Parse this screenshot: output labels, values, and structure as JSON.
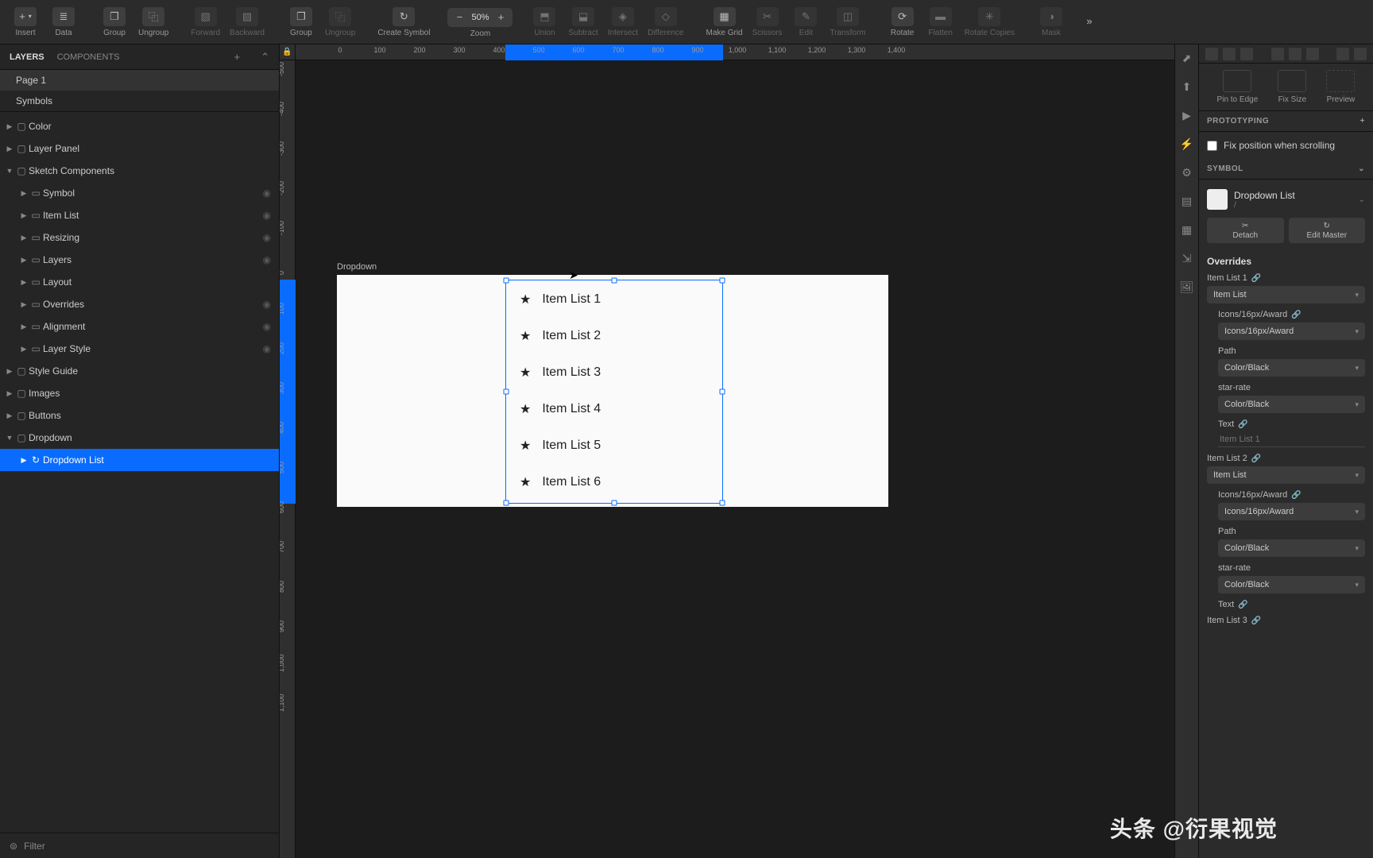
{
  "toolbar": {
    "insert": "Insert",
    "data": "Data",
    "group": "Group",
    "ungroup": "Ungroup",
    "forward": "Forward",
    "backward": "Backward",
    "group2": "Group",
    "ungroup2": "Ungroup",
    "create_symbol": "Create Symbol",
    "zoom": "Zoom",
    "zoom_value": "50%",
    "union": "Union",
    "subtract": "Subtract",
    "intersect": "Intersect",
    "difference": "Difference",
    "make_grid": "Make Grid",
    "scissors": "Scissors",
    "edit": "Edit",
    "transform": "Transform",
    "rotate": "Rotate",
    "flatten": "Flatten",
    "rotate_copies": "Rotate Copies",
    "mask": "Mask"
  },
  "left": {
    "tab_layers": "LAYERS",
    "tab_components": "COMPONENTS",
    "page1": "Page 1",
    "symbols": "Symbols",
    "filter": "Filter",
    "groups": {
      "color": "Color",
      "layer_panel": "Layer Panel",
      "sketch_components": "Sketch Components",
      "symbol": "Symbol",
      "item_list": "Item List",
      "resizing": "Resizing",
      "layers": "Layers",
      "layout": "Layout",
      "overrides": "Overrides",
      "alignment": "Alignment",
      "layer_style": "Layer Style",
      "style_guide": "Style Guide",
      "images": "Images",
      "buttons": "Buttons",
      "dropdown": "Dropdown",
      "dropdown_list": "Dropdown List"
    }
  },
  "canvas": {
    "artboard_label": "Dropdown",
    "h_ticks": [
      "0",
      "100",
      "200",
      "300",
      "400",
      "500",
      "600",
      "700",
      "800",
      "900",
      "1,000",
      "1,100",
      "1,200",
      "1,300",
      "1,400"
    ],
    "v_ticks": [
      "-500",
      "-400",
      "-300",
      "-200",
      "-100",
      "0",
      "100",
      "200",
      "300",
      "400",
      "500",
      "600",
      "700",
      "800",
      "900",
      "1,000",
      "1,100"
    ],
    "items": [
      "Item List 1",
      "Item List 2",
      "Item List 3",
      "Item List 4",
      "Item List 5",
      "Item List 6"
    ]
  },
  "right": {
    "pin_to_edge": "Pin to Edge",
    "fix_size": "Fix Size",
    "preview": "Preview",
    "prototyping": "PROTOTYPING",
    "fix_pos": "Fix position when scrolling",
    "symbol_h": "SYMBOL",
    "symbol_name": "Dropdown List",
    "symbol_path": "/",
    "detach": "Detach",
    "edit_master": "Edit Master",
    "overrides_h": "Overrides",
    "ov": [
      {
        "title": "Item List 1",
        "sym": "Item List",
        "icon_l": "Icons/16px/Award",
        "icon_v": "Icons/16px/Award",
        "path_l": "Path",
        "path_v": "Color/Black",
        "star_l": "star-rate",
        "star_v": "Color/Black",
        "text_l": "Text",
        "text_ph": "Item List 1"
      },
      {
        "title": "Item List 2",
        "sym": "Item List",
        "icon_l": "Icons/16px/Award",
        "icon_v": "Icons/16px/Award",
        "path_l": "Path",
        "path_v": "Color/Black",
        "star_l": "star-rate",
        "star_v": "Color/Black",
        "text_l": "Text",
        "text_ph": ""
      },
      {
        "title": "Item List 3"
      }
    ]
  },
  "watermark": "头条 @衍果视觉"
}
